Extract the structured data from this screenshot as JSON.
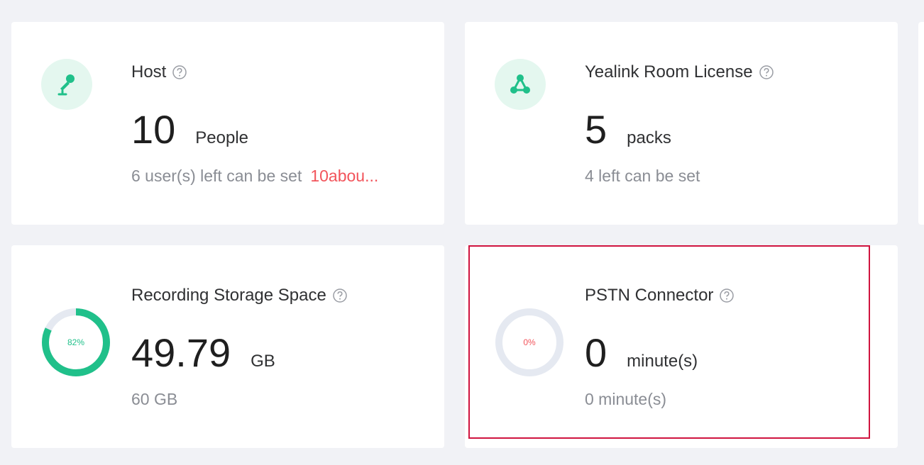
{
  "cards": {
    "host": {
      "title": "Host",
      "value": "10",
      "unit": "People",
      "subtext": "6 user(s) left can be set",
      "link": "10abou..."
    },
    "license": {
      "title": "Yealink Room License",
      "value": "5",
      "unit": "packs",
      "subtext": "4 left can be set"
    },
    "storage": {
      "title": "Recording Storage Space",
      "value": "49.79",
      "unit": "GB",
      "subtext": "60 GB",
      "percent_label": "82%",
      "percent": 82
    },
    "pstn": {
      "title": "PSTN Connector",
      "value": "0",
      "unit": "minute(s)",
      "subtext": "0 minute(s)",
      "percent_label": "0%",
      "percent": 0
    }
  },
  "colors": {
    "accent_green": "#20c08a",
    "icon_bg": "#e4f7ef",
    "ring_track": "#e5e9f1",
    "warning_red": "#f2545b",
    "highlight_border": "#d0143f"
  },
  "icons": {
    "host": "microphone-icon",
    "license": "network-nodes-icon",
    "help": "question-circle-icon"
  }
}
